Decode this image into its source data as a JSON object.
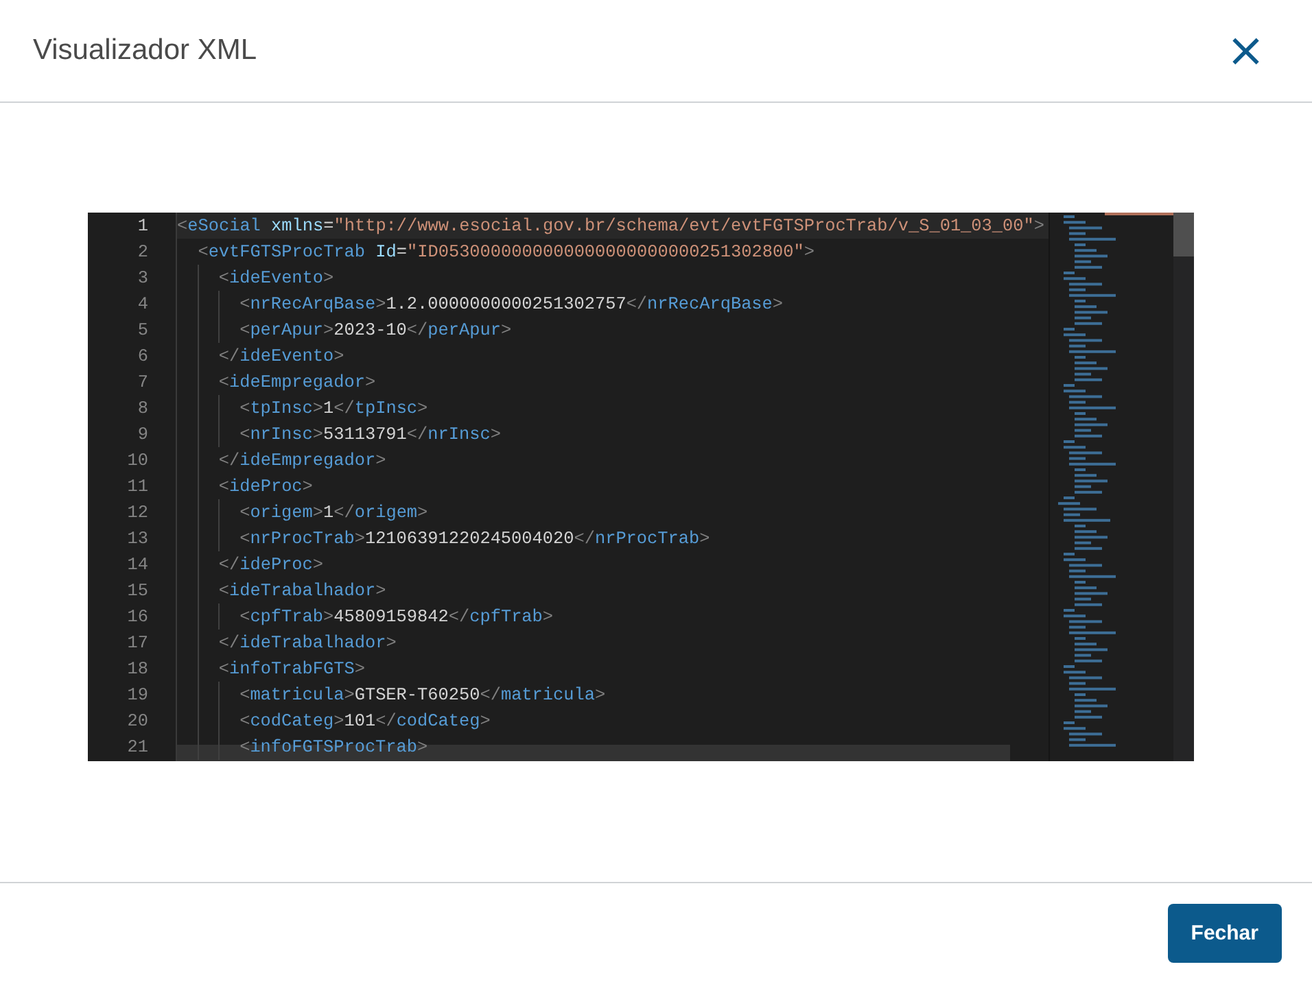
{
  "dialog": {
    "title": "Visualizador XML",
    "close_icon": "×"
  },
  "editor": {
    "lines": [
      {
        "number": "1",
        "tokens": [
          {
            "kind": "punct",
            "text": "<"
          },
          {
            "kind": "tag",
            "text": "eSocial"
          },
          {
            "kind": "attr",
            "text": " xmlns"
          },
          {
            "kind": "text",
            "text": "="
          },
          {
            "kind": "value",
            "text": "\"http://www.esocial.gov.br/schema/evt/evtFGTSProcTrab/v_S_01_03_00\""
          },
          {
            "kind": "punct",
            "text": ">"
          }
        ],
        "children": [
          {
            "number": "2",
            "tokens": [
              {
                "kind": "punct",
                "text": "<"
              },
              {
                "kind": "tag",
                "text": "evtFGTSProcTrab"
              },
              {
                "kind": "attr",
                "text": " Id"
              },
              {
                "kind": "text",
                "text": "="
              },
              {
                "kind": "value",
                "text": "\"ID0530000000000000000000000251302800\""
              },
              {
                "kind": "punct",
                "text": ">"
              }
            ],
            "children": [
              {
                "number": "3",
                "tokens": [
                  {
                    "kind": "punct",
                    "text": "<"
                  },
                  {
                    "kind": "tag",
                    "text": "ideEvento"
                  },
                  {
                    "kind": "punct",
                    "text": ">"
                  }
                ],
                "children": [
                  {
                    "number": "4",
                    "tokens": [
                      {
                        "kind": "punct",
                        "text": "<"
                      },
                      {
                        "kind": "tag",
                        "text": "nrRecArqBase"
                      },
                      {
                        "kind": "punct",
                        "text": ">"
                      },
                      {
                        "kind": "text",
                        "text": "1.2.0000000000251302757"
                      },
                      {
                        "kind": "punct",
                        "text": "</"
                      },
                      {
                        "kind": "tag",
                        "text": "nrRecArqBase"
                      },
                      {
                        "kind": "punct",
                        "text": ">"
                      }
                    ]
                  },
                  {
                    "number": "5",
                    "tokens": [
                      {
                        "kind": "punct",
                        "text": "<"
                      },
                      {
                        "kind": "tag",
                        "text": "perApur"
                      },
                      {
                        "kind": "punct",
                        "text": ">"
                      },
                      {
                        "kind": "text",
                        "text": "2023-10"
                      },
                      {
                        "kind": "punct",
                        "text": "</"
                      },
                      {
                        "kind": "tag",
                        "text": "perApur"
                      },
                      {
                        "kind": "punct",
                        "text": ">"
                      }
                    ]
                  }
                ]
              },
              {
                "number": "6",
                "tokens": [
                  {
                    "kind": "punct",
                    "text": "</"
                  },
                  {
                    "kind": "tag",
                    "text": "ideEvento"
                  },
                  {
                    "kind": "punct",
                    "text": ">"
                  }
                ]
              },
              {
                "number": "7",
                "tokens": [
                  {
                    "kind": "punct",
                    "text": "<"
                  },
                  {
                    "kind": "tag",
                    "text": "ideEmpregador"
                  },
                  {
                    "kind": "punct",
                    "text": ">"
                  }
                ],
                "children": [
                  {
                    "number": "8",
                    "tokens": [
                      {
                        "kind": "punct",
                        "text": "<"
                      },
                      {
                        "kind": "tag",
                        "text": "tpInsc"
                      },
                      {
                        "kind": "punct",
                        "text": ">"
                      },
                      {
                        "kind": "text",
                        "text": "1"
                      },
                      {
                        "kind": "punct",
                        "text": "</"
                      },
                      {
                        "kind": "tag",
                        "text": "tpInsc"
                      },
                      {
                        "kind": "punct",
                        "text": ">"
                      }
                    ]
                  },
                  {
                    "number": "9",
                    "tokens": [
                      {
                        "kind": "punct",
                        "text": "<"
                      },
                      {
                        "kind": "tag",
                        "text": "nrInsc"
                      },
                      {
                        "kind": "punct",
                        "text": ">"
                      },
                      {
                        "kind": "text",
                        "text": "53113791"
                      },
                      {
                        "kind": "punct",
                        "text": "</"
                      },
                      {
                        "kind": "tag",
                        "text": "nrInsc"
                      },
                      {
                        "kind": "punct",
                        "text": ">"
                      }
                    ]
                  }
                ]
              },
              {
                "number": "10",
                "tokens": [
                  {
                    "kind": "punct",
                    "text": "</"
                  },
                  {
                    "kind": "tag",
                    "text": "ideEmpregador"
                  },
                  {
                    "kind": "punct",
                    "text": ">"
                  }
                ]
              },
              {
                "number": "11",
                "tokens": [
                  {
                    "kind": "punct",
                    "text": "<"
                  },
                  {
                    "kind": "tag",
                    "text": "ideProc"
                  },
                  {
                    "kind": "punct",
                    "text": ">"
                  }
                ],
                "children": [
                  {
                    "number": "12",
                    "tokens": [
                      {
                        "kind": "punct",
                        "text": "<"
                      },
                      {
                        "kind": "tag",
                        "text": "origem"
                      },
                      {
                        "kind": "punct",
                        "text": ">"
                      },
                      {
                        "kind": "text",
                        "text": "1"
                      },
                      {
                        "kind": "punct",
                        "text": "</"
                      },
                      {
                        "kind": "tag",
                        "text": "origem"
                      },
                      {
                        "kind": "punct",
                        "text": ">"
                      }
                    ]
                  },
                  {
                    "number": "13",
                    "tokens": [
                      {
                        "kind": "punct",
                        "text": "<"
                      },
                      {
                        "kind": "tag",
                        "text": "nrProcTrab"
                      },
                      {
                        "kind": "punct",
                        "text": ">"
                      },
                      {
                        "kind": "text",
                        "text": "12106391220245004020"
                      },
                      {
                        "kind": "punct",
                        "text": "</"
                      },
                      {
                        "kind": "tag",
                        "text": "nrProcTrab"
                      },
                      {
                        "kind": "punct",
                        "text": ">"
                      }
                    ]
                  }
                ]
              },
              {
                "number": "14",
                "tokens": [
                  {
                    "kind": "punct",
                    "text": "</"
                  },
                  {
                    "kind": "tag",
                    "text": "ideProc"
                  },
                  {
                    "kind": "punct",
                    "text": ">"
                  }
                ]
              },
              {
                "number": "15",
                "tokens": [
                  {
                    "kind": "punct",
                    "text": "<"
                  },
                  {
                    "kind": "tag",
                    "text": "ideTrabalhador"
                  },
                  {
                    "kind": "punct",
                    "text": ">"
                  }
                ],
                "children": [
                  {
                    "number": "16",
                    "tokens": [
                      {
                        "kind": "punct",
                        "text": "<"
                      },
                      {
                        "kind": "tag",
                        "text": "cpfTrab"
                      },
                      {
                        "kind": "punct",
                        "text": ">"
                      },
                      {
                        "kind": "text",
                        "text": "45809159842"
                      },
                      {
                        "kind": "punct",
                        "text": "</"
                      },
                      {
                        "kind": "tag",
                        "text": "cpfTrab"
                      },
                      {
                        "kind": "punct",
                        "text": ">"
                      }
                    ]
                  }
                ]
              },
              {
                "number": "17",
                "tokens": [
                  {
                    "kind": "punct",
                    "text": "</"
                  },
                  {
                    "kind": "tag",
                    "text": "ideTrabalhador"
                  },
                  {
                    "kind": "punct",
                    "text": ">"
                  }
                ]
              },
              {
                "number": "18",
                "tokens": [
                  {
                    "kind": "punct",
                    "text": "<"
                  },
                  {
                    "kind": "tag",
                    "text": "infoTrabFGTS"
                  },
                  {
                    "kind": "punct",
                    "text": ">"
                  }
                ],
                "children": [
                  {
                    "number": "19",
                    "tokens": [
                      {
                        "kind": "punct",
                        "text": "<"
                      },
                      {
                        "kind": "tag",
                        "text": "matricula"
                      },
                      {
                        "kind": "punct",
                        "text": ">"
                      },
                      {
                        "kind": "text",
                        "text": "GTSER-T60250"
                      },
                      {
                        "kind": "punct",
                        "text": "</"
                      },
                      {
                        "kind": "tag",
                        "text": "matricula"
                      },
                      {
                        "kind": "punct",
                        "text": ">"
                      }
                    ]
                  },
                  {
                    "number": "20",
                    "tokens": [
                      {
                        "kind": "punct",
                        "text": "<"
                      },
                      {
                        "kind": "tag",
                        "text": "codCateg"
                      },
                      {
                        "kind": "punct",
                        "text": ">"
                      },
                      {
                        "kind": "text",
                        "text": "101"
                      },
                      {
                        "kind": "punct",
                        "text": "</"
                      },
                      {
                        "kind": "tag",
                        "text": "codCateg"
                      },
                      {
                        "kind": "punct",
                        "text": ">"
                      }
                    ]
                  },
                  {
                    "number": "21",
                    "tokens": [
                      {
                        "kind": "punct",
                        "text": "<"
                      },
                      {
                        "kind": "tag",
                        "text": "infoFGTSProcTrab"
                      },
                      {
                        "kind": "punct",
                        "text": ">"
                      }
                    ]
                  }
                ]
              }
            ]
          }
        ]
      }
    ]
  },
  "footer": {
    "buttons": [
      "Fechar"
    ]
  }
}
